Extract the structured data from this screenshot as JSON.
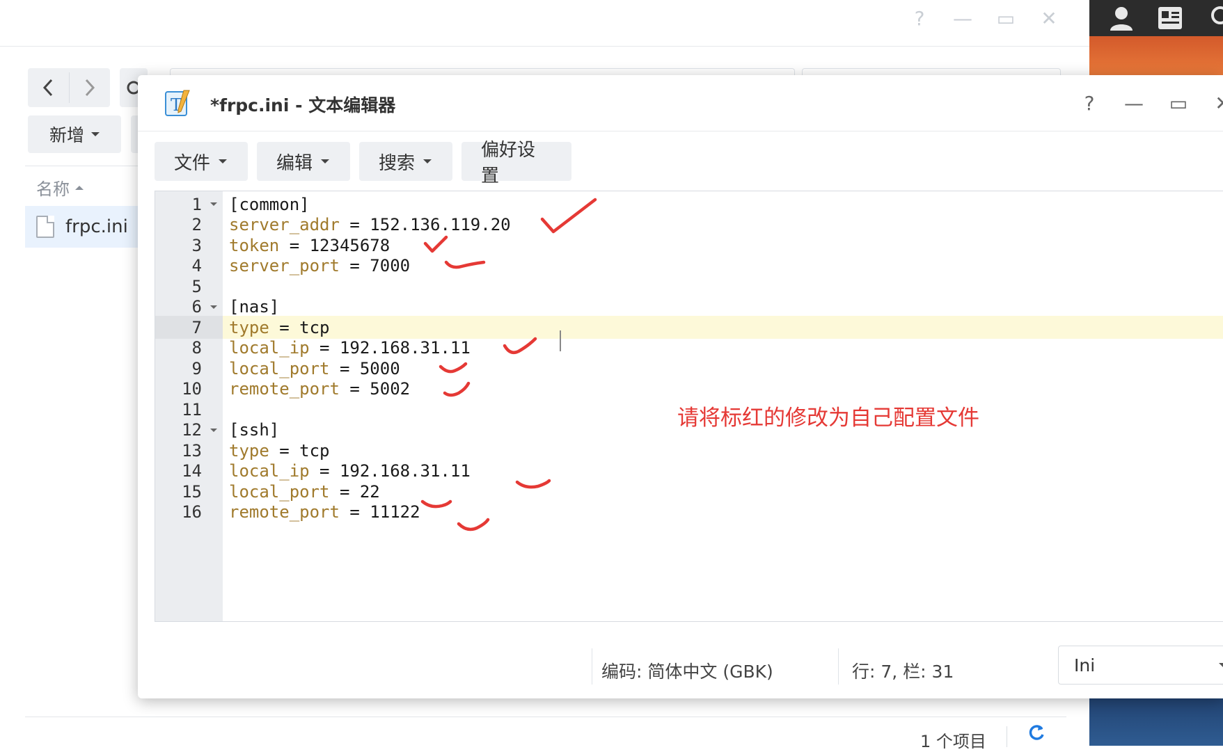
{
  "file_station": {
    "window_controls": {
      "help": "?",
      "minimize": "—",
      "maximize": "▭",
      "close": "✕"
    },
    "new_button_label": "新增",
    "column_header_name": "名称",
    "file_name": "frpc.ini",
    "item_count": "1 个项目"
  },
  "editor": {
    "title": "*frpc.ini - 文本编辑器",
    "window_controls": {
      "help": "?",
      "minimize": "—",
      "maximize": "▭",
      "close": "✕"
    },
    "menus": [
      {
        "label": "文件"
      },
      {
        "label": "编辑"
      },
      {
        "label": "搜索"
      },
      {
        "label": "偏好设置"
      }
    ],
    "lines": [
      {
        "n": "1",
        "key": "",
        "rest": "[common]"
      },
      {
        "n": "2",
        "key": "server_addr",
        "rest": " = 152.136.119.20"
      },
      {
        "n": "3",
        "key": "token",
        "rest": " = 12345678"
      },
      {
        "n": "4",
        "key": "server_port",
        "rest": " = 7000"
      },
      {
        "n": "5",
        "key": "",
        "rest": ""
      },
      {
        "n": "6",
        "key": "",
        "rest": "[nas]"
      },
      {
        "n": "7",
        "key": "type",
        "rest": " = tcp"
      },
      {
        "n": "8",
        "key": "local_ip",
        "rest": " = 192.168.31.11"
      },
      {
        "n": "9",
        "key": "local_port",
        "rest": " = 5000"
      },
      {
        "n": "10",
        "key": "remote_port",
        "rest": " = 5002"
      },
      {
        "n": "11",
        "key": "",
        "rest": ""
      },
      {
        "n": "12",
        "key": "",
        "rest": "[ssh]"
      },
      {
        "n": "13",
        "key": "type",
        "rest": " = tcp"
      },
      {
        "n": "14",
        "key": "local_ip",
        "rest": " = 192.168.31.11"
      },
      {
        "n": "15",
        "key": "local_port",
        "rest": " = 22"
      },
      {
        "n": "16",
        "key": "remote_port",
        "rest": " = 11122"
      }
    ],
    "active_line": 7,
    "annotation": "请将标红的修改为自己配置文件",
    "status": {
      "encoding": "编码: 简体中文 (GBK)",
      "position": "行: 7, 栏: 31",
      "language": "Ini"
    }
  },
  "colors": {
    "annotation_red": "#e53935",
    "key_color": "#a07a2c",
    "active_line_bg": "#fdf9d9"
  }
}
